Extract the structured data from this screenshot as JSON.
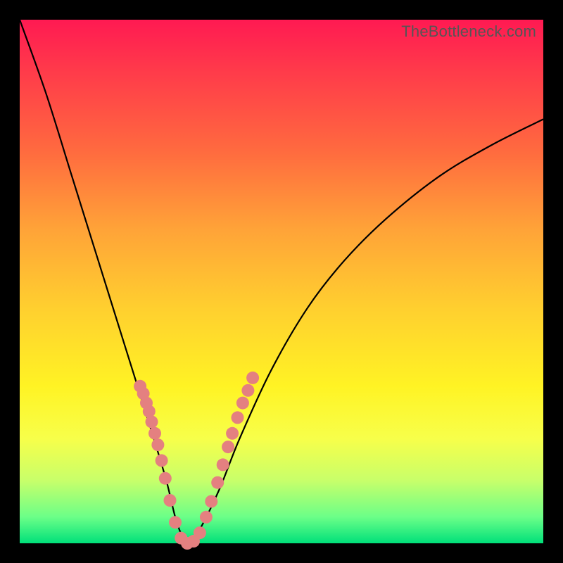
{
  "watermark": "TheBottleneck.com",
  "chart_data": {
    "type": "line",
    "title": "",
    "xlabel": "",
    "ylabel": "",
    "xlim": [
      0,
      1
    ],
    "ylim": [
      0,
      1
    ],
    "series": [
      {
        "name": "bottleneck-curve",
        "x": [
          0.0,
          0.05,
          0.1,
          0.15,
          0.2,
          0.25,
          0.28,
          0.3,
          0.32,
          0.34,
          0.38,
          0.42,
          0.48,
          0.55,
          0.62,
          0.7,
          0.8,
          0.9,
          1.0
        ],
        "y": [
          1.0,
          0.86,
          0.7,
          0.54,
          0.38,
          0.22,
          0.12,
          0.04,
          0.0,
          0.02,
          0.1,
          0.2,
          0.33,
          0.45,
          0.54,
          0.62,
          0.7,
          0.76,
          0.81
        ]
      }
    ],
    "scatter_overlay": {
      "name": "sample-points",
      "color": "#e48080",
      "points": [
        {
          "x": 0.23,
          "y": 0.3
        },
        {
          "x": 0.236,
          "y": 0.286
        },
        {
          "x": 0.242,
          "y": 0.268
        },
        {
          "x": 0.247,
          "y": 0.252
        },
        {
          "x": 0.252,
          "y": 0.232
        },
        {
          "x": 0.258,
          "y": 0.21
        },
        {
          "x": 0.264,
          "y": 0.188
        },
        {
          "x": 0.271,
          "y": 0.158
        },
        {
          "x": 0.278,
          "y": 0.124
        },
        {
          "x": 0.287,
          "y": 0.082
        },
        {
          "x": 0.297,
          "y": 0.04
        },
        {
          "x": 0.308,
          "y": 0.01
        },
        {
          "x": 0.32,
          "y": 0.0
        },
        {
          "x": 0.332,
          "y": 0.004
        },
        {
          "x": 0.344,
          "y": 0.02
        },
        {
          "x": 0.356,
          "y": 0.05
        },
        {
          "x": 0.366,
          "y": 0.08
        },
        {
          "x": 0.378,
          "y": 0.116
        },
        {
          "x": 0.388,
          "y": 0.15
        },
        {
          "x": 0.398,
          "y": 0.184
        },
        {
          "x": 0.406,
          "y": 0.21
        },
        {
          "x": 0.416,
          "y": 0.24
        },
        {
          "x": 0.426,
          "y": 0.268
        },
        {
          "x": 0.436,
          "y": 0.292
        },
        {
          "x": 0.445,
          "y": 0.316
        }
      ]
    }
  }
}
